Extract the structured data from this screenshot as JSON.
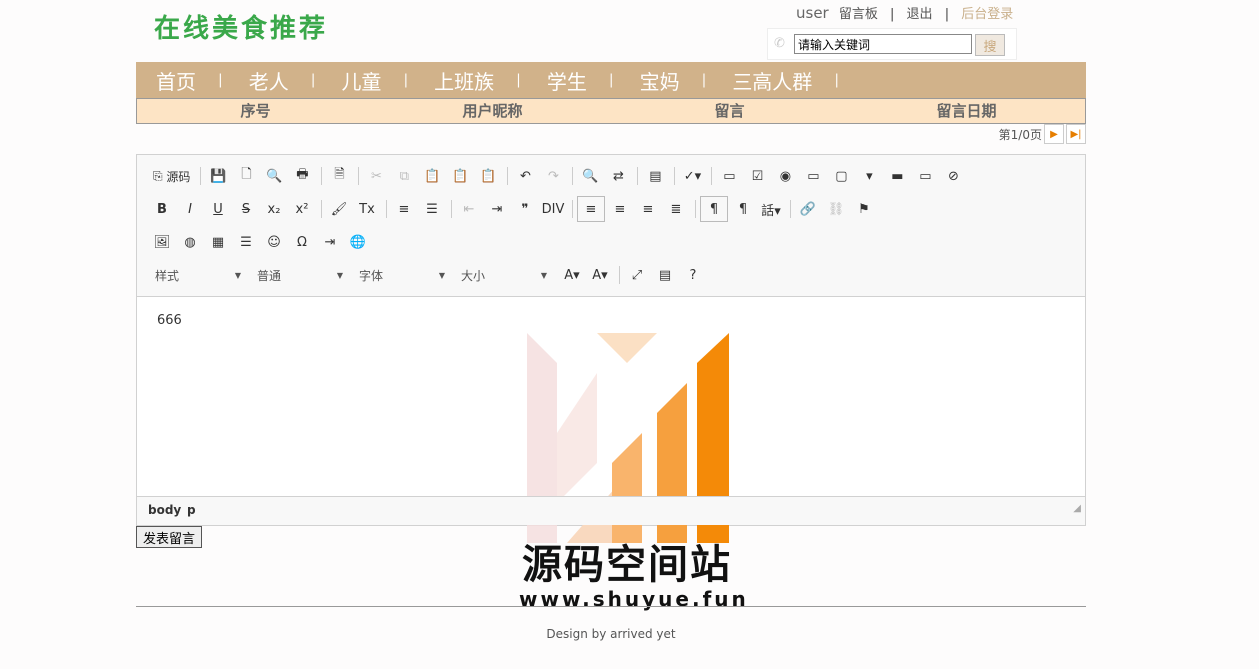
{
  "header": {
    "logo": "在线美食推荐",
    "user": "user",
    "links": [
      "留言板",
      "退出",
      "后台登录"
    ],
    "search_placeholder": "请输入关键词",
    "search_button": "搜"
  },
  "nav": [
    "首页",
    "老人",
    "儿童",
    "上班族",
    "学生",
    "宝妈",
    "三高人群"
  ],
  "table": {
    "columns": [
      "序号",
      "用户昵称",
      "留言",
      "留言日期"
    ]
  },
  "pager": {
    "text": "第1/0页"
  },
  "editor": {
    "source_label": "源码",
    "combos": [
      "样式",
      "普通",
      "字体",
      "大小"
    ],
    "content": "666",
    "path": [
      "body",
      "p"
    ]
  },
  "watermark": {
    "title": "源码空间站",
    "url": "www.shuyue.fun"
  },
  "submit_label": "发表留言",
  "footer": "Design by arrived yet"
}
